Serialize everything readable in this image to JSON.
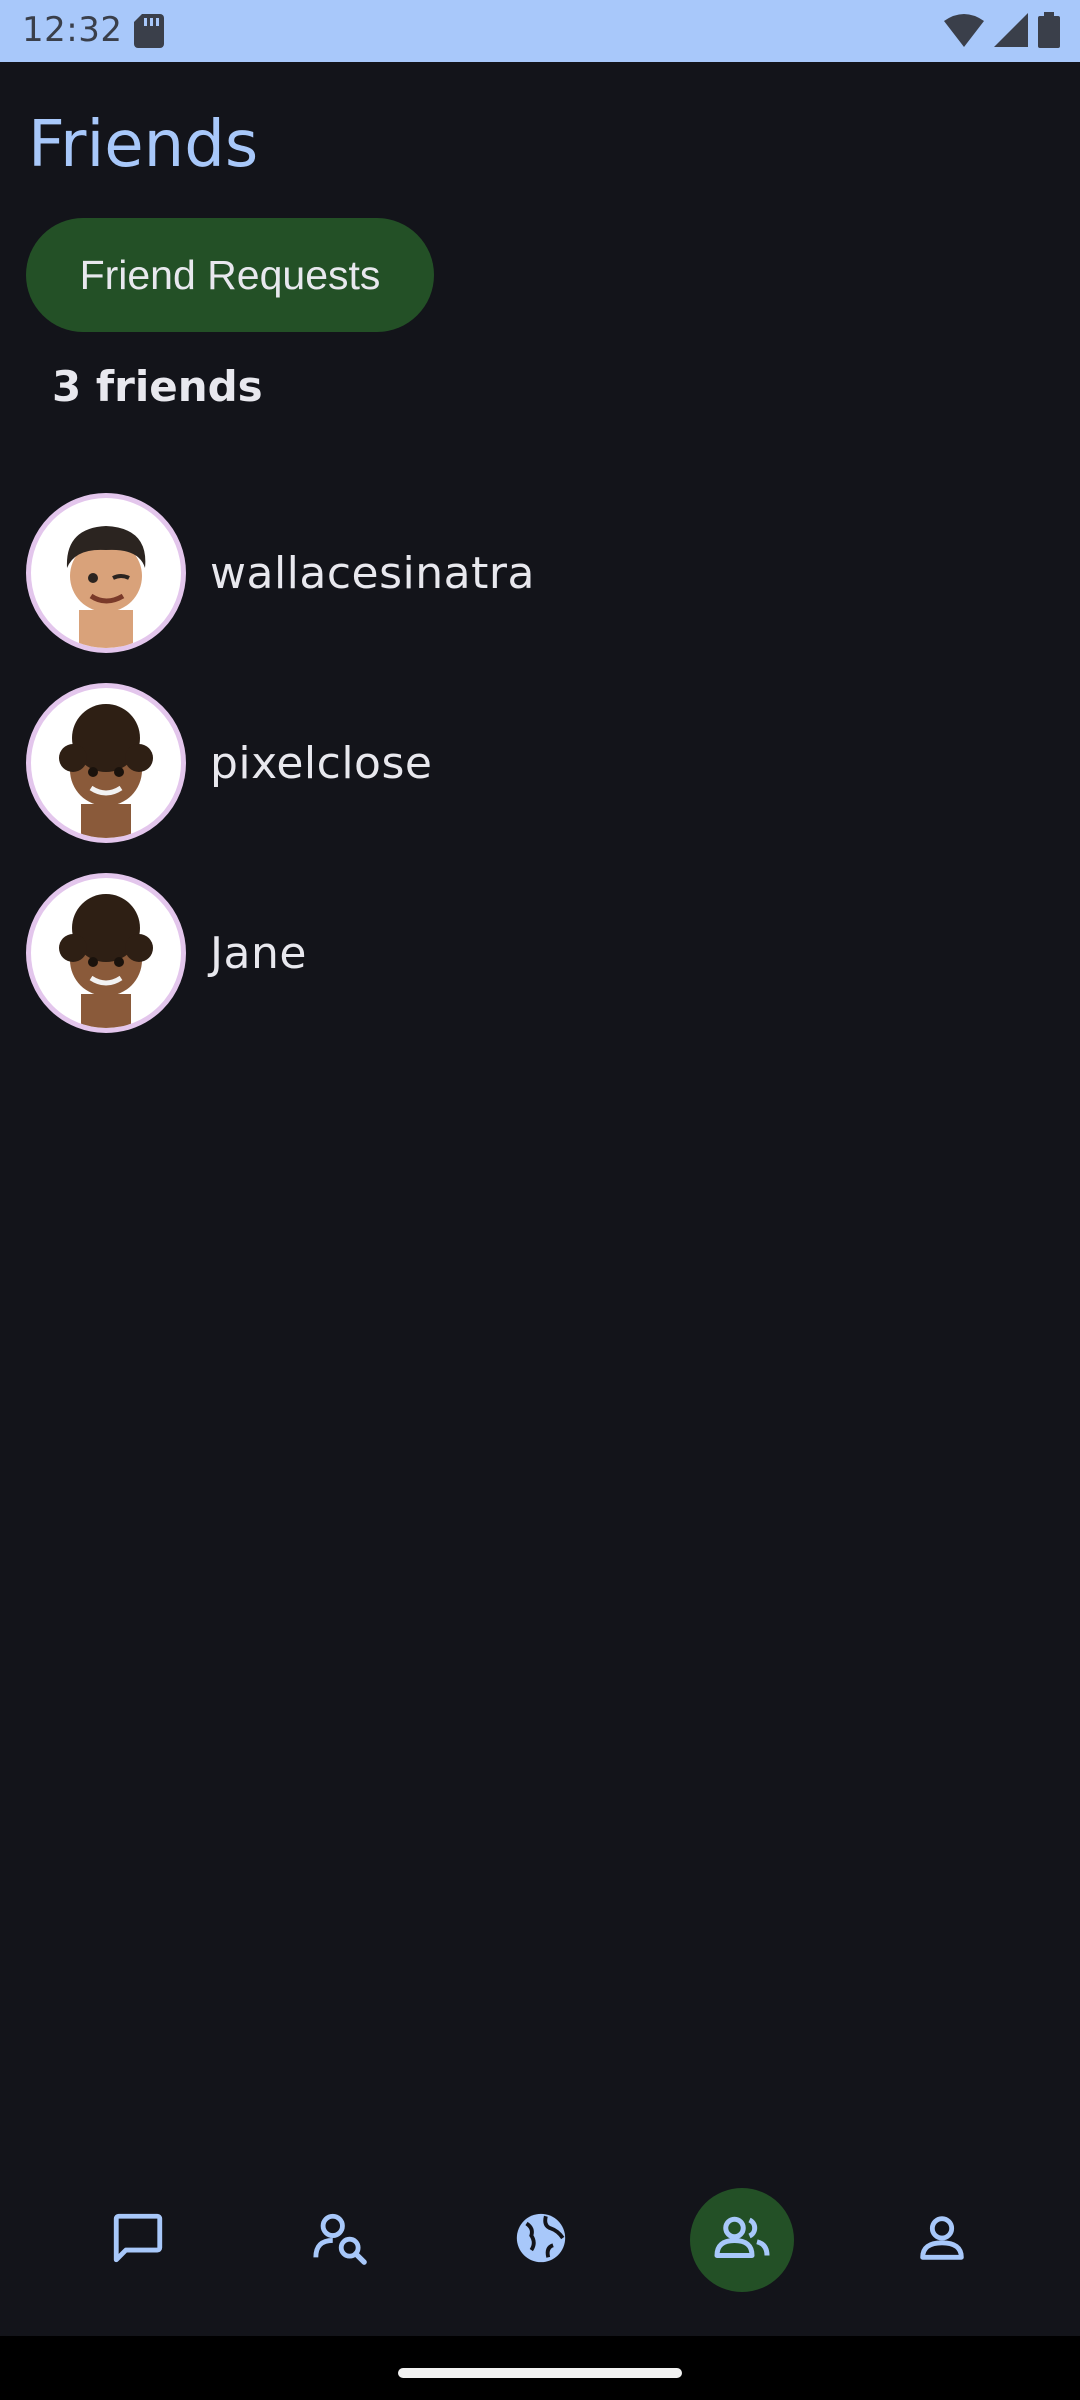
{
  "status_bar": {
    "time": "12:32"
  },
  "header": {
    "title": "Friends"
  },
  "friend_requests_button": {
    "label": "Friend Requests"
  },
  "friends_count": "3 friends",
  "friends": [
    {
      "name": "wallacesinatra",
      "avatar": "memoji-avatar-winking"
    },
    {
      "name": "pixelclose",
      "avatar": "memoji-avatar-curly-hair"
    },
    {
      "name": "Jane",
      "avatar": "memoji-avatar-curly-hair"
    }
  ],
  "bottom_nav": [
    {
      "id": "chats",
      "icon": "chat-bubble-icon",
      "active": false
    },
    {
      "id": "search-users",
      "icon": "person-search-icon",
      "active": false
    },
    {
      "id": "explore",
      "icon": "globe-icon",
      "active": false
    },
    {
      "id": "friends",
      "icon": "people-icon",
      "active": true
    },
    {
      "id": "profile",
      "icon": "person-icon",
      "active": false
    }
  ],
  "colors": {
    "background": "#13141a",
    "accent": "#a8c8fa",
    "active_green": "#235026",
    "avatar_ring": "#e3c6ec"
  }
}
